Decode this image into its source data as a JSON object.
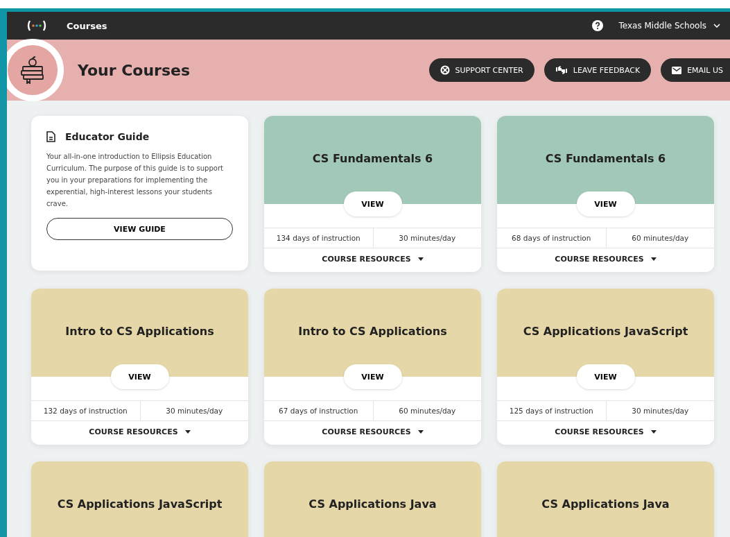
{
  "top_bar": {
    "title": "Courses",
    "organization": "Texas Middle Schools"
  },
  "banner": {
    "title": "Your Courses",
    "buttons": [
      {
        "label": "SUPPORT CENTER",
        "kind": "support"
      },
      {
        "label": "LEAVE FEEDBACK",
        "kind": "feedback"
      },
      {
        "label": "EMAIL US",
        "kind": "email"
      }
    ]
  },
  "guide": {
    "title": "Educator Guide",
    "text": "Your all-in-one introduction to Ellipsis Education Curriculum. The purpose of this guide is to support you in your preparations for implementing the experential, high-interest lessons your students crave.",
    "button": "VIEW GUIDE"
  },
  "courses": [
    {
      "title": "CS Fundamentals 6",
      "color": "#a2c9b8",
      "view": "VIEW",
      "days": "134 days of instruction",
      "minutes": "30 minutes/day",
      "resources": "COURSE RESOURCES"
    },
    {
      "title": "CS Fundamentals 6",
      "color": "#a2c9b8",
      "view": "VIEW",
      "days": "68 days of instruction",
      "minutes": "60 minutes/day",
      "resources": "COURSE RESOURCES"
    },
    {
      "title": "Intro to CS Applications",
      "color": "#e6d7a9",
      "view": "VIEW",
      "days": "132 days of instruction",
      "minutes": "30 minutes/day",
      "resources": "COURSE RESOURCES"
    },
    {
      "title": "Intro to CS Applications",
      "color": "#e6d7a9",
      "view": "VIEW",
      "days": "67 days of instruction",
      "minutes": "60 minutes/day",
      "resources": "COURSE RESOURCES"
    },
    {
      "title": "CS Applications JavaScript",
      "color": "#e6d7a9",
      "view": "VIEW",
      "days": "125 days of instruction",
      "minutes": "30 minutes/day",
      "resources": "COURSE RESOURCES"
    },
    {
      "title": "CS Applications JavaScript",
      "color": "#e6d7a9"
    },
    {
      "title": "CS Applications Java",
      "color": "#e6d7a9"
    },
    {
      "title": "CS Applications Java",
      "color": "#e6d7a9"
    }
  ]
}
